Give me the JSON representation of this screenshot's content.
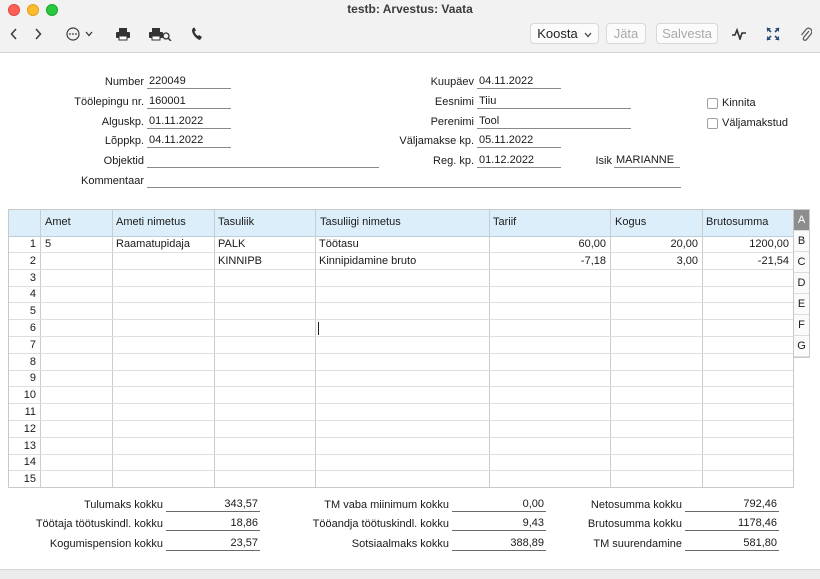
{
  "window": {
    "title": "testb: Arvestus: Vaata"
  },
  "toolbar": {
    "back_icon": "chevron-left",
    "forward_icon": "chevron-right",
    "more_icon": "ellipsis-circle",
    "print_icon": "printer",
    "print_preview_icon": "printer-search",
    "phone_icon": "phone",
    "koosta_label": "Koosta",
    "jata_label": "Jäta",
    "salvesta_label": "Salvesta",
    "activity_icon": "activity-wave",
    "expand_icon": "expand-arrows",
    "attach_icon": "paperclip"
  },
  "header": {
    "number_label": "Number",
    "number_value": "220049",
    "tooleping_label": "Töölepingu nr.",
    "tooleping_value": "160001",
    "alguskp_label": "Alguskp.",
    "alguskp_value": "01.11.2022",
    "loppkp_label": "Lõppkp.",
    "loppkp_value": "04.11.2022",
    "objektid_label": "Objektid",
    "objektid_value": "",
    "kommentaar_label": "Kommentaar",
    "kommentaar_value": "",
    "kuupaev_label": "Kuupäev",
    "kuupaev_value": "04.11.2022",
    "eesnimi_label": "Eesnimi",
    "eesnimi_value": "Tiiu",
    "perenimi_label": "Perenimi",
    "perenimi_value": "Tool",
    "valjamakse_label": "Väljamakse kp.",
    "valjamakse_value": "05.11.2022",
    "regkp_label": "Reg. kp.",
    "regkp_value": "01.12.2022",
    "isik_label": "Isik",
    "isik_value": "MARIANNE",
    "kinnita_label": "Kinnita",
    "valjamakstud_label": "Väljamakstud"
  },
  "grid": {
    "columns": [
      "Amet",
      "Ameti nimetus",
      "Tasuliik",
      "Tasuliigi nimetus",
      "Tariif",
      "Kogus",
      "Brutosumma"
    ],
    "row_numbers": [
      "1",
      "2",
      "3",
      "4",
      "5",
      "6",
      "7",
      "8",
      "9",
      "10",
      "11",
      "12",
      "13",
      "14",
      "15"
    ],
    "rows": [
      {
        "amet": "5",
        "ameti_nimetus": "Raamatupidaja",
        "tasuliik": "PALK",
        "tasuliigi_nimetus": "Töötasu",
        "tariif": "60,00",
        "kogus": "20,00",
        "brutosumma": "1200,00"
      },
      {
        "amet": "",
        "ameti_nimetus": "",
        "tasuliik": "KINNIPB",
        "tasuliigi_nimetus": "Kinnipidamine bruto",
        "tariif": "-7,18",
        "kogus": "3,00",
        "brutosumma": "-21,54"
      }
    ],
    "side_tabs": [
      "A",
      "B",
      "C",
      "D",
      "E",
      "F",
      "G"
    ],
    "active_tab": "A"
  },
  "totals": {
    "tulumaks_label": "Tulumaks kokku",
    "tulumaks_value": "343,57",
    "tootaja_label": "Töötaja töötuskindl. kokku",
    "tootaja_value": "18,86",
    "kogumis_label": "Kogumispension kokku",
    "kogumis_value": "23,57",
    "tm_vaba_label": "TM vaba miinimum kokku",
    "tm_vaba_value": "0,00",
    "tooandja_label": "Tööandja töötuskindl. kokku",
    "tooandja_value": "9,43",
    "sots_label": "Sotsiaalmaks kokku",
    "sots_value": "388,89",
    "neto_label": "Netosumma kokku",
    "neto_value": "792,46",
    "bruto_label": "Brutosumma kokku",
    "bruto_value": "1178,46",
    "tm_suur_label": "TM suurendamine",
    "tm_suur_value": "581,80"
  }
}
